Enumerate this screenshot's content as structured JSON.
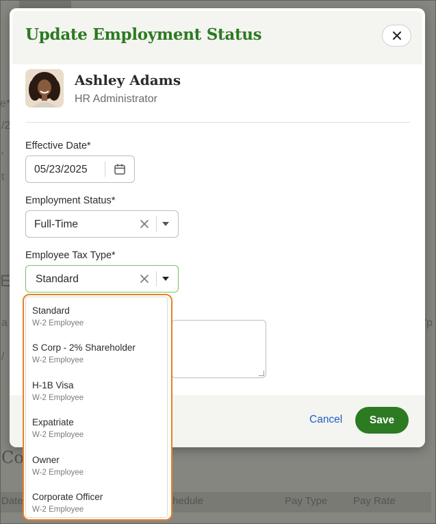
{
  "background": {
    "fragments": [
      "e*",
      "/2",
      "'",
      "t",
      "E",
      "a",
      "/",
      "'p"
    ],
    "heading_fragment": "Co",
    "table_headers": [
      "Date",
      "hedule",
      "Pay Type",
      "Pay Rate"
    ]
  },
  "modal": {
    "title": "Update Employment Status",
    "close_icon": "close-icon",
    "employee": {
      "name": "Ashley Adams",
      "role": "HR Administrator"
    },
    "effective_date": {
      "label": "Effective Date*",
      "value": "05/23/2025",
      "icon": "calendar-icon"
    },
    "employment_status": {
      "label": "Employment Status*",
      "value": "Full-Time"
    },
    "tax_type": {
      "label": "Employee Tax Type*",
      "value": "Standard"
    },
    "footer": {
      "cancel_label": "Cancel",
      "save_label": "Save"
    }
  },
  "dropdown": {
    "options": [
      {
        "title": "Standard",
        "subtitle": "W-2 Employee"
      },
      {
        "title": "S Corp - 2% Shareholder",
        "subtitle": "W-2 Employee"
      },
      {
        "title": "H-1B Visa",
        "subtitle": "W-2 Employee"
      },
      {
        "title": "Expatriate",
        "subtitle": "W-2 Employee"
      },
      {
        "title": "Owner",
        "subtitle": "W-2 Employee"
      },
      {
        "title": "Corporate Officer",
        "subtitle": "W-2 Employee"
      }
    ]
  },
  "colors": {
    "brand_green": "#2c7a22",
    "link_blue": "#1f5fc4",
    "highlight_orange": "#e9801e",
    "focus_green": "#7bbf66"
  }
}
